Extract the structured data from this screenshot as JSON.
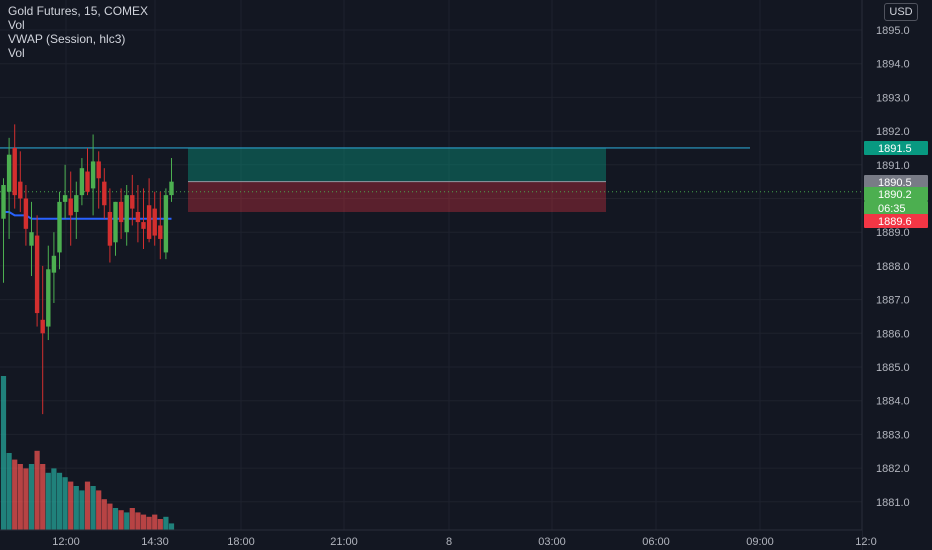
{
  "legend": {
    "symbol": "Gold Futures, 15, COMEX",
    "vol1": "Vol",
    "vwap": "VWAP (Session, hlc3)",
    "vol2": "Vol"
  },
  "currency": "USD",
  "colors": {
    "background": "#131722",
    "up": "#26a69a",
    "up_candle": "#4caf50",
    "down": "#ef5350",
    "down_candle": "#d32f2f",
    "vwap": "#2962ff",
    "target_line": "#2a9fc9",
    "grid": "#1e222d"
  },
  "chart_data": {
    "type": "candlestick",
    "title": "Gold Futures, 15, COMEX",
    "y_axis": {
      "ylim": [
        1880.6,
        1895.3
      ],
      "ticks": [
        1881.0,
        1882.0,
        1883.0,
        1884.0,
        1885.0,
        1886.0,
        1887.0,
        1888.0,
        1889.0,
        1890.0,
        1891.0,
        1892.0,
        1893.0,
        1894.0,
        1895.0
      ]
    },
    "x_axis": {
      "ticks": [
        "12:00",
        "14:30",
        "18:00",
        "21:00",
        "8",
        "03:00",
        "06:00",
        "09:00",
        "12:0"
      ]
    },
    "candles": [
      {
        "o": 1889.4,
        "h": 1890.6,
        "l": 1887.5,
        "c": 1890.4
      },
      {
        "o": 1890.2,
        "h": 1891.8,
        "l": 1888.8,
        "c": 1891.3
      },
      {
        "o": 1891.5,
        "h": 1892.2,
        "l": 1889.7,
        "c": 1890.1
      },
      {
        "o": 1890.5,
        "h": 1891.4,
        "l": 1889.6,
        "c": 1890.0
      },
      {
        "o": 1890.0,
        "h": 1890.4,
        "l": 1888.6,
        "c": 1889.1
      },
      {
        "o": 1888.6,
        "h": 1889.9,
        "l": 1887.7,
        "c": 1889.0
      },
      {
        "o": 1888.9,
        "h": 1889.5,
        "l": 1886.2,
        "c": 1886.6
      },
      {
        "o": 1886.4,
        "h": 1888.0,
        "l": 1883.6,
        "c": 1886.0
      },
      {
        "o": 1886.2,
        "h": 1888.6,
        "l": 1885.8,
        "c": 1887.9
      },
      {
        "o": 1887.8,
        "h": 1889.0,
        "l": 1886.9,
        "c": 1888.3
      },
      {
        "o": 1888.4,
        "h": 1890.2,
        "l": 1887.9,
        "c": 1889.9
      },
      {
        "o": 1889.9,
        "h": 1891.0,
        "l": 1889.4,
        "c": 1890.1
      },
      {
        "o": 1890.0,
        "h": 1890.8,
        "l": 1888.6,
        "c": 1889.5
      },
      {
        "o": 1889.6,
        "h": 1890.5,
        "l": 1888.8,
        "c": 1890.1
      },
      {
        "o": 1890.1,
        "h": 1891.2,
        "l": 1889.8,
        "c": 1890.9
      },
      {
        "o": 1890.8,
        "h": 1891.5,
        "l": 1890.1,
        "c": 1890.2
      },
      {
        "o": 1890.3,
        "h": 1891.9,
        "l": 1889.5,
        "c": 1891.1
      },
      {
        "o": 1891.1,
        "h": 1891.4,
        "l": 1889.7,
        "c": 1890.6
      },
      {
        "o": 1890.5,
        "h": 1890.9,
        "l": 1889.4,
        "c": 1889.8
      },
      {
        "o": 1889.6,
        "h": 1890.3,
        "l": 1888.1,
        "c": 1888.6
      },
      {
        "o": 1888.7,
        "h": 1889.9,
        "l": 1888.3,
        "c": 1889.9
      },
      {
        "o": 1889.9,
        "h": 1890.3,
        "l": 1888.8,
        "c": 1889.3
      },
      {
        "o": 1889.0,
        "h": 1890.4,
        "l": 1888.6,
        "c": 1890.1
      },
      {
        "o": 1890.1,
        "h": 1890.7,
        "l": 1889.2,
        "c": 1889.7
      },
      {
        "o": 1889.6,
        "h": 1890.4,
        "l": 1888.7,
        "c": 1889.3
      },
      {
        "o": 1889.3,
        "h": 1890.3,
        "l": 1888.5,
        "c": 1889.1
      },
      {
        "o": 1889.8,
        "h": 1890.6,
        "l": 1888.7,
        "c": 1888.8
      },
      {
        "o": 1889.7,
        "h": 1890.2,
        "l": 1888.6,
        "c": 1888.9
      },
      {
        "o": 1889.2,
        "h": 1890.2,
        "l": 1888.2,
        "c": 1888.8
      },
      {
        "o": 1888.4,
        "h": 1890.3,
        "l": 1888.2,
        "c": 1890.1
      },
      {
        "o": 1890.1,
        "h": 1891.2,
        "l": 1889.9,
        "c": 1890.5
      }
    ],
    "volume": [
      0.7,
      0.35,
      0.32,
      0.3,
      0.28,
      0.3,
      0.36,
      0.3,
      0.26,
      0.28,
      0.26,
      0.24,
      0.22,
      0.2,
      0.18,
      0.22,
      0.2,
      0.18,
      0.14,
      0.12,
      0.1,
      0.09,
      0.08,
      0.1,
      0.08,
      0.07,
      0.06,
      0.07,
      0.05,
      0.06,
      0.03
    ],
    "vwap": [
      1889.6,
      1889.6,
      1889.5,
      1889.5,
      1889.5,
      1889.4,
      1889.4,
      1889.4,
      1889.4,
      1889.4,
      1889.4,
      1889.4,
      1889.4,
      1889.4,
      1889.4,
      1889.4,
      1889.4,
      1889.4,
      1889.4,
      1889.4,
      1889.4,
      1889.4,
      1889.4,
      1889.4,
      1889.4,
      1889.4,
      1889.4,
      1889.4,
      1889.4,
      1889.4,
      1889.4
    ],
    "target_line": 1891.5,
    "position": {
      "entry": 1890.5,
      "target": 1891.5,
      "stop": 1889.6
    },
    "price_labels": [
      {
        "text": "1891.5",
        "value": 1891.5,
        "color": "#089981"
      },
      {
        "text": "1890.5",
        "value": 1890.5,
        "color": "#787b86"
      },
      {
        "text": "1890.2",
        "value": 1890.2,
        "color": "#4caf50"
      },
      {
        "text": "06:35",
        "value": 1889.8,
        "color": "#4caf50"
      },
      {
        "text": "1889.6",
        "value": 1889.6,
        "color": "#f23645"
      }
    ],
    "last_price": 1890.2
  }
}
